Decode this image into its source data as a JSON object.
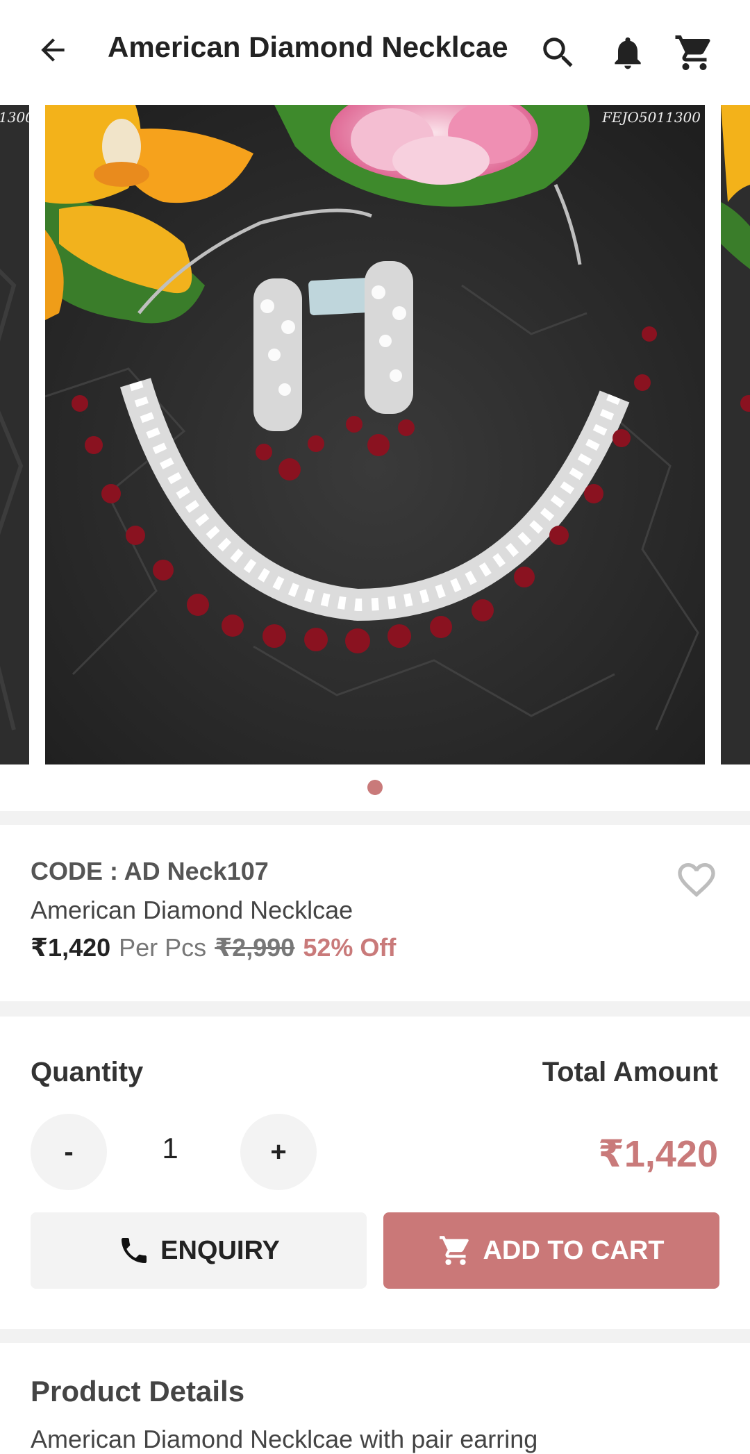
{
  "header": {
    "title": "American Diamond Necklcae",
    "icons": [
      "back-arrow-icon",
      "search-icon",
      "bell-icon",
      "cart-icon"
    ]
  },
  "gallery": {
    "watermark_left": "1300",
    "watermark_main": "FEJO5011300",
    "image_description_icon": "necklace-earring-set-photo"
  },
  "product": {
    "code": "CODE : AD Neck107",
    "name": "American Diamond Necklcae",
    "price": "₹1,420",
    "unit": "Per Pcs",
    "mrp": "₹2,990",
    "discount": "52% Off"
  },
  "quantity": {
    "label": "Quantity",
    "minus": "-",
    "value": "1",
    "plus": "+",
    "total_label": "Total Amount",
    "total_value": "₹1,420"
  },
  "actions": {
    "enquiry": "ENQUIRY",
    "add_to_cart": "ADD TO CART"
  },
  "details": {
    "title": "Product Details",
    "description": "American Diamond Necklcae with pair earring"
  },
  "colors": {
    "accent": "#c97a7a",
    "button_bg": "#f3f3f3",
    "separator": "#f2f2f2"
  }
}
